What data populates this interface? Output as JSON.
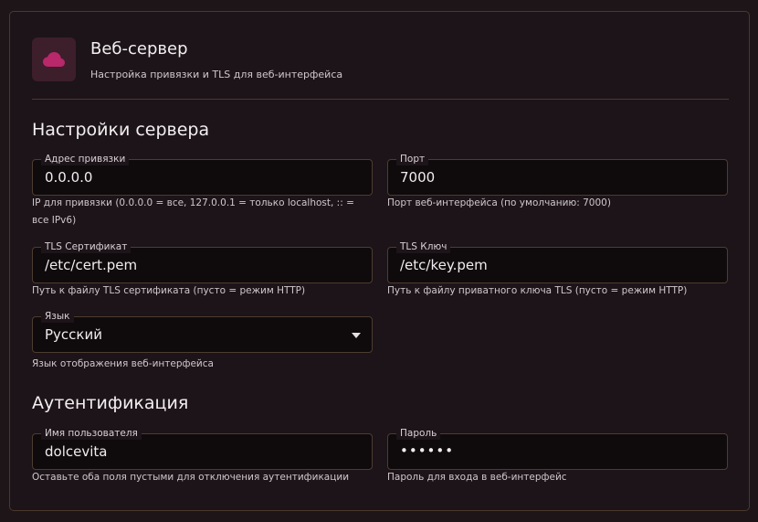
{
  "header": {
    "title": "Веб-сервер",
    "subtitle": "Настройка привязки и TLS для веб-интерфейса",
    "icon": "cloud-icon",
    "accent": "#b8286a"
  },
  "server_section": {
    "title": "Настройки сервера",
    "bind_address": {
      "label": "Адрес привязки",
      "value": "0.0.0.0",
      "helper": "IP для привязки (0.0.0.0 = все, 127.0.0.1 = только localhost, :: = все IPv6)"
    },
    "port": {
      "label": "Порт",
      "value": "7000",
      "helper": "Порт веб-интерфейса (по умолчанию: 7000)"
    },
    "tls_cert": {
      "label": "TLS Сертификат",
      "value": "/etc/cert.pem",
      "helper": "Путь к файлу TLS сертификата (пусто = режим HTTP)"
    },
    "tls_key": {
      "label": "TLS Ключ",
      "value": "/etc/key.pem",
      "helper": "Путь к файлу приватного ключа TLS (пусто = режим HTTP)"
    },
    "language": {
      "label": "Язык",
      "value": "Русский",
      "helper": "Язык отображения веб-интерфейса"
    }
  },
  "auth_section": {
    "title": "Аутентификация",
    "username": {
      "label": "Имя пользователя",
      "value": "dolcevita",
      "helper": "Оставьте оба поля пустыми для отключения аутентификации"
    },
    "password": {
      "label": "Пароль",
      "value": "••••••",
      "helper": "Пароль для входа в веб-интерфейс"
    }
  }
}
